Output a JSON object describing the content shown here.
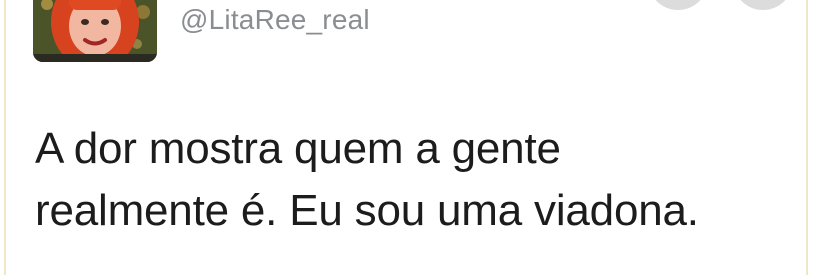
{
  "tweet": {
    "handle": "@LitaRee_real",
    "text_lines": [
      "A dor mostra quem a gente",
      "realmente é. Eu sou uma viadona."
    ]
  },
  "avatar": {
    "icon": "user-avatar-photo"
  },
  "header_buttons": [
    {
      "icon": "follow-button"
    },
    {
      "icon": "more-options-button"
    }
  ],
  "colors": {
    "handle": "#8a8d91",
    "text": "#1c1c1c",
    "border": "#ece8c8",
    "button": "#dcdcdc"
  }
}
